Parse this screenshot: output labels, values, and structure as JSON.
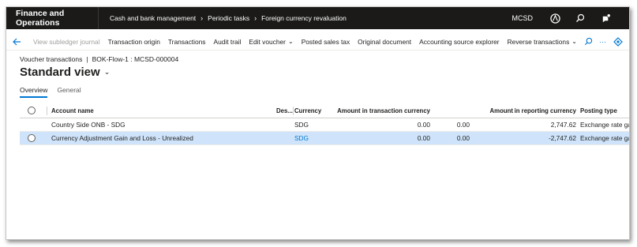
{
  "topbar": {
    "app_title": "Finance and Operations",
    "breadcrumbs": [
      "Cash and bank management",
      "Periodic tasks",
      "Foreign currency revaluation"
    ],
    "company": "MCSD"
  },
  "actionbar": {
    "view_subledger": "View subledger journal",
    "transaction_origin": "Transaction origin",
    "transactions": "Transactions",
    "audit_trail": "Audit trail",
    "edit_voucher": "Edit voucher",
    "posted_sales_tax": "Posted sales tax",
    "original_document": "Original document",
    "accounting_source_explorer": "Accounting source explorer",
    "reverse_transactions": "Reverse transactions",
    "more": "···"
  },
  "breadcrumb": {
    "section": "Voucher transactions",
    "sep": "|",
    "record": "BOK-Flow-1 : MCSD-000004"
  },
  "page": {
    "title": "Standard view"
  },
  "tabs": [
    "Overview",
    "General"
  ],
  "grid": {
    "headers": {
      "account_name": "Account name",
      "description": "Des...",
      "currency": "Currency",
      "amount_tx": "Amount in transaction currency",
      "amount": "Amount",
      "amount_rep": "Amount in reporting currency",
      "posting_type": "Posting type"
    },
    "rows": [
      {
        "account_name": "Country Side ONB - SDG",
        "description": "",
        "currency": "SDG",
        "amount_tx": "0.00",
        "amount_extra": "0.00",
        "amount": "",
        "amount_rep": "2,747.62",
        "posting_type": "Exchange rate gain"
      },
      {
        "account_name": "Currency Adjustment Gain and Loss - Unrealized",
        "description": "",
        "currency": "SDG",
        "amount_tx": "0.00",
        "amount_extra": "0.00",
        "amount": "",
        "amount_rep": "-2,747.62",
        "posting_type": "Exchange rate gain"
      }
    ]
  }
}
